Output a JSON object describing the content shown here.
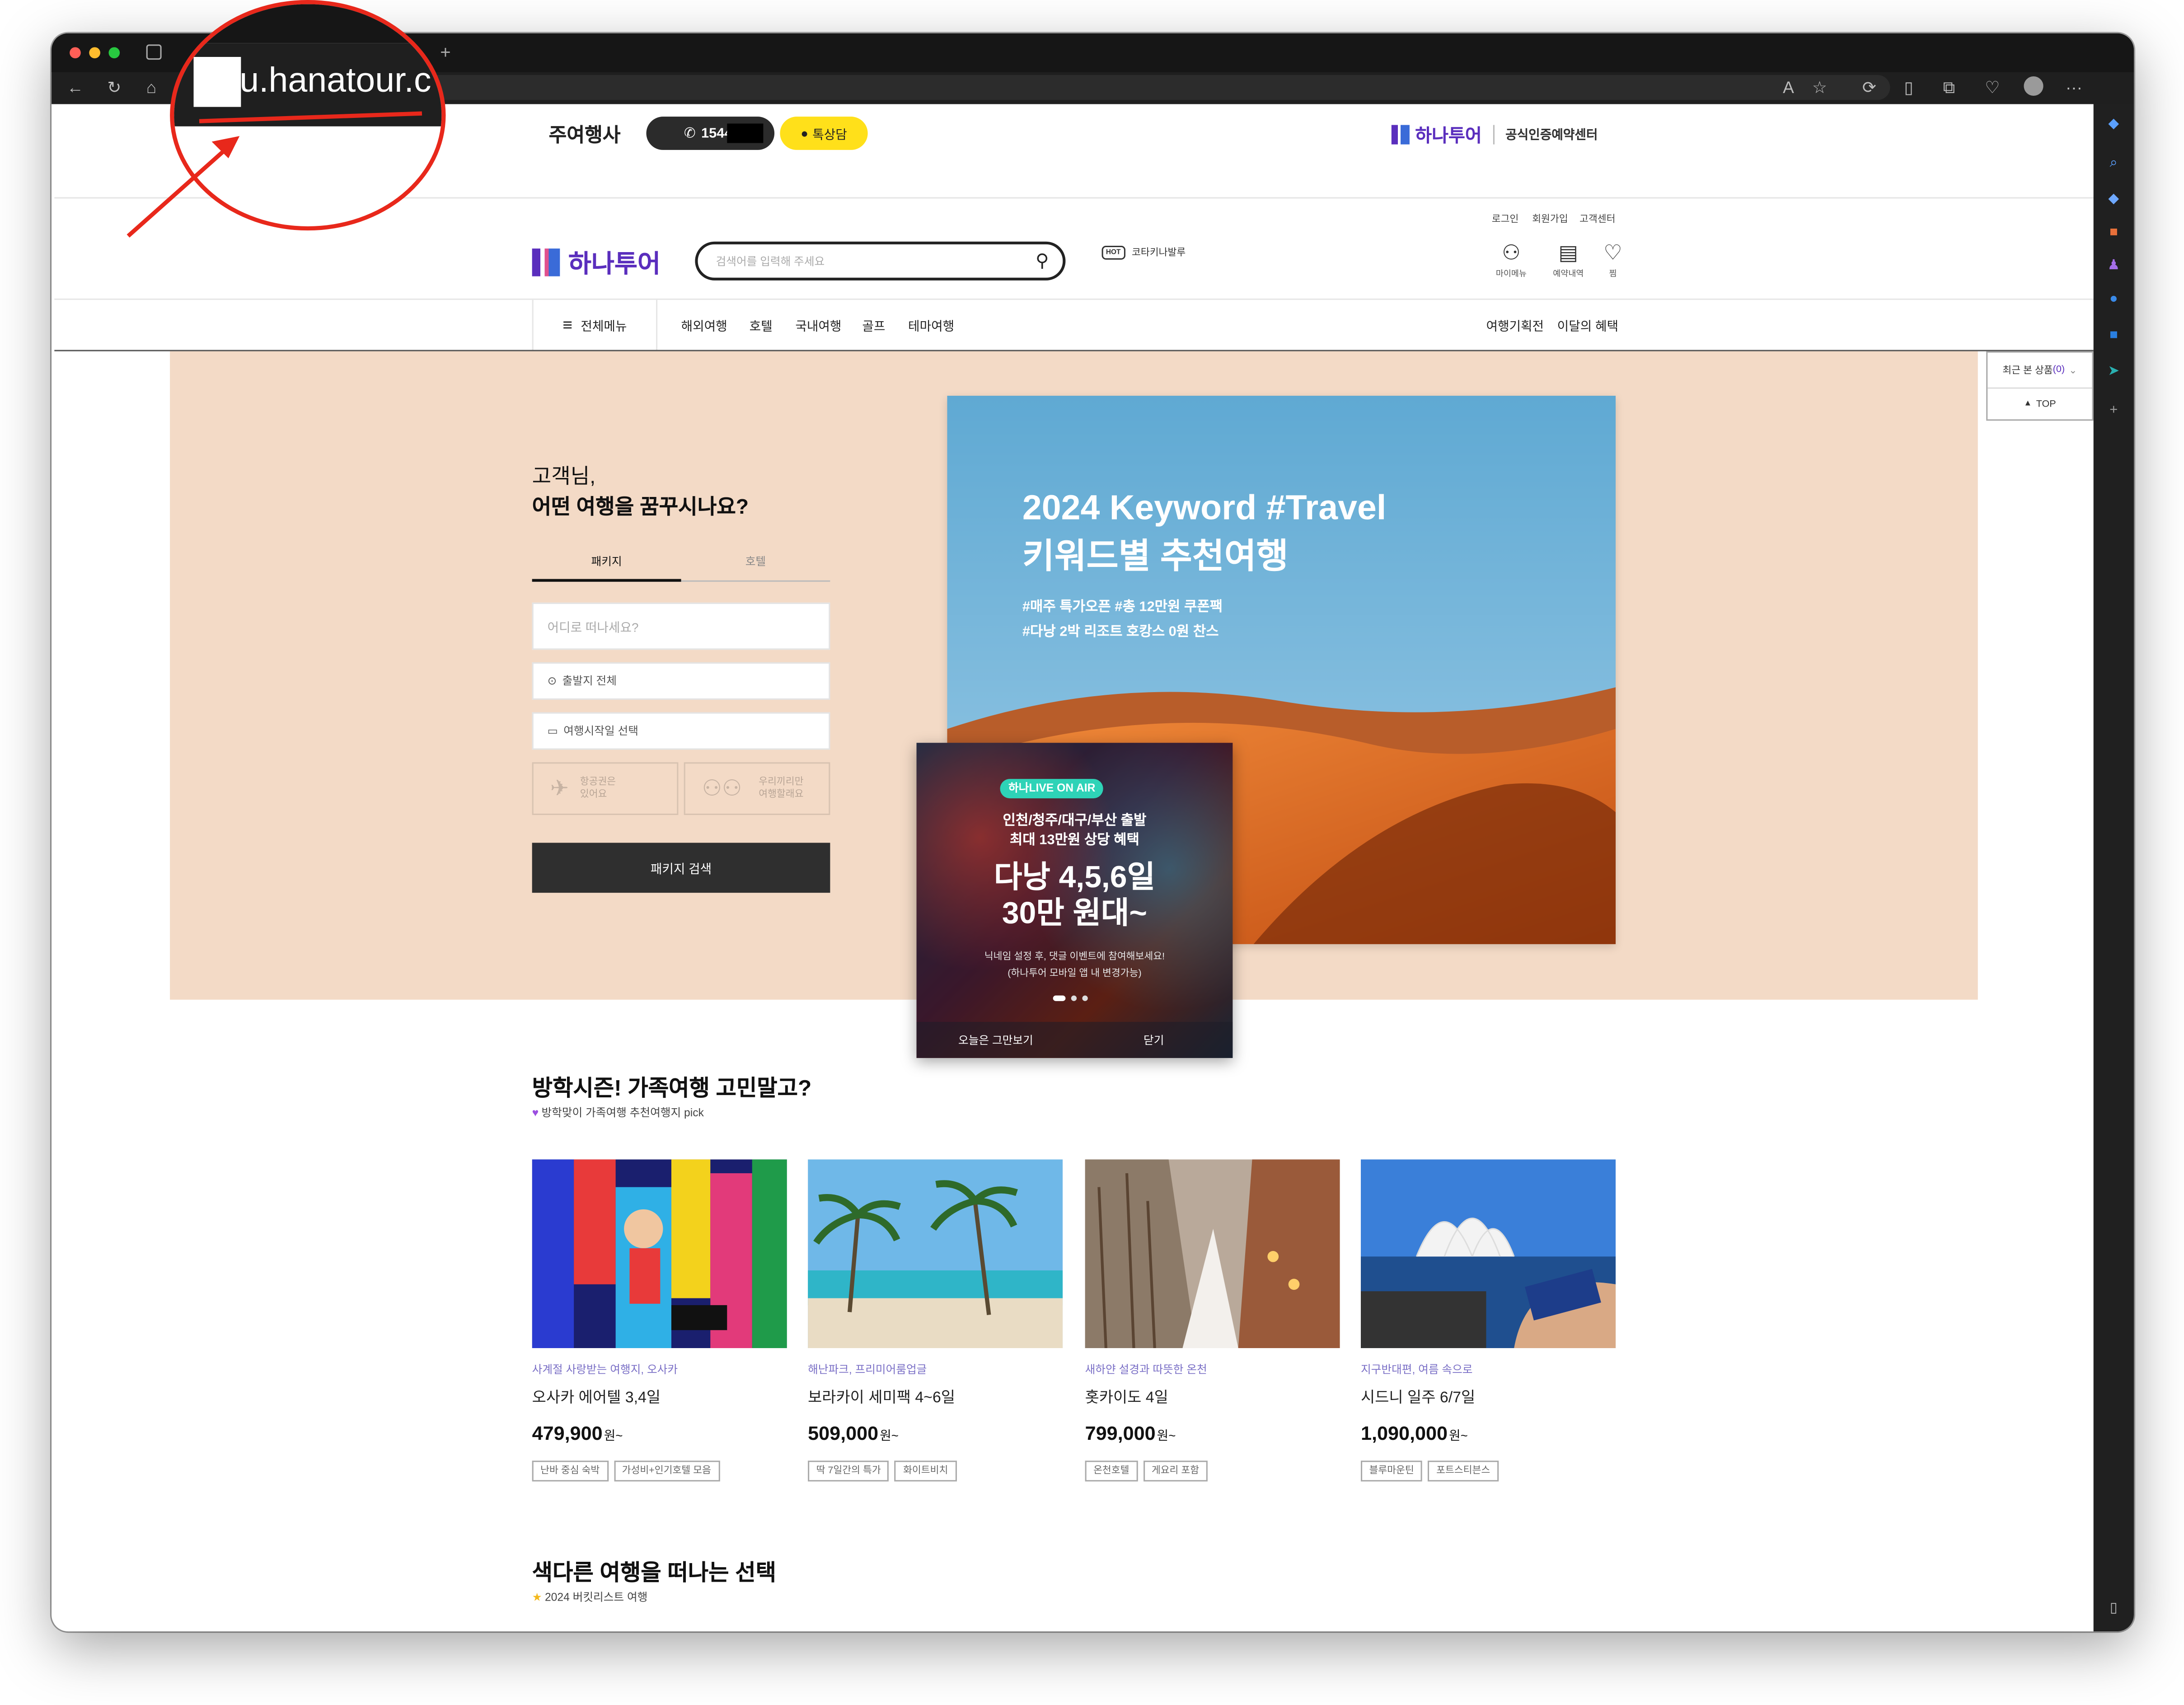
{
  "browser": {
    "url_visible": "u.hanatour.c",
    "colors": {
      "annotation": "#e8281b"
    }
  },
  "topbar": {
    "agency_label": "주여행사",
    "phone_label": "1544-",
    "chat_label": "톡상담",
    "brand": "하나투어",
    "certified_label": "공식인증예약센터"
  },
  "header": {
    "logo": "하나투어",
    "search_placeholder": "검색어를 입력해 주세요",
    "hot_badge": "HOT",
    "hot_text": "코타키나발루",
    "util_links": [
      "로그인",
      "회원가입",
      "고객센터"
    ],
    "icons": [
      {
        "label": "마이메뉴",
        "icon": "user-icon"
      },
      {
        "label": "예약내역",
        "icon": "document-icon"
      },
      {
        "label": "찜",
        "icon": "heart-icon"
      }
    ]
  },
  "nav": {
    "all_menu": "전체메뉴",
    "items": [
      "해외여행",
      "호텔",
      "국내여행",
      "골프",
      "테마여행"
    ],
    "right_items": [
      "여행기획전",
      "이달의 혜택"
    ]
  },
  "side_widget": {
    "recent_label": "최근 본 상품",
    "recent_count": "(0)",
    "top_label": "TOP"
  },
  "search_panel": {
    "greeting_line1": "고객님,",
    "greeting_line2": "어떤 여행을 꿈꾸시나요?",
    "tabs": [
      "패키지",
      "호텔"
    ],
    "destination_placeholder": "어디로 떠나세요?",
    "departure_label": "출발지 전체",
    "date_label": "여행시작일 선택",
    "option1_line1": "항공권은",
    "option1_line2": "있어요",
    "option2_line1": "우리끼리만",
    "option2_line2": "여행할래요",
    "submit_label": "패키지 검색"
  },
  "banner": {
    "title_line1": "2024 Keyword #Travel",
    "title_line2": "키워드별 추천여행",
    "sub_line1": "#매주 특가오픈 #총 12만원 쿠폰팩",
    "sub_line2": "#다낭 2박 리조트 호캉스 0원 찬스"
  },
  "popup": {
    "badge": "하나LIVE ON AIR",
    "line1": "인천/청주/대구/부산 출발",
    "line2": "최대 13만원 상당 혜택",
    "headline1": "다낭 4,5,6일",
    "headline2": "30만 원대~",
    "note1": "닉네임 설정 후, 댓글 이벤트에 참여해보세요!",
    "note2": "(하나투어 모바일 앱 내 변경가능)",
    "hide_today": "오늘은 그만보기",
    "close": "닫기"
  },
  "section1": {
    "title": "방학시즌! 가족여행 고민말고?",
    "subtitle": "방학맞이 가족여행 추천여행지 pick",
    "cards": [
      {
        "category": "사계절 사랑받는 여행지, 오사카",
        "title": "오사카 에어텔 3,4일",
        "price": "479,900",
        "unit": "원~",
        "tags": [
          "난바 중심 숙박",
          "가성비+인기호텔 모음"
        ]
      },
      {
        "category": "해난파크, 프리미어룸업글",
        "title": "보라카이 세미팩 4~6일",
        "price": "509,000",
        "unit": "원~",
        "tags": [
          "딱 7일간의 특가",
          "화이트비치"
        ]
      },
      {
        "category": "새하얀 설경과 따뜻한 온천",
        "title": "홋카이도 4일",
        "price": "799,000",
        "unit": "원~",
        "tags": [
          "온천호텔",
          "게요리 포함"
        ]
      },
      {
        "category": "지구반대편, 여름 속으로",
        "title": "시드니 일주 6/7일",
        "price": "1,090,000",
        "unit": "원~",
        "tags": [
          "블루마운틴",
          "포트스티븐스"
        ]
      }
    ]
  },
  "section2": {
    "title": "색다른 여행을 떠나는 선택",
    "subtitle": "2024 버킷리스트 여행"
  }
}
